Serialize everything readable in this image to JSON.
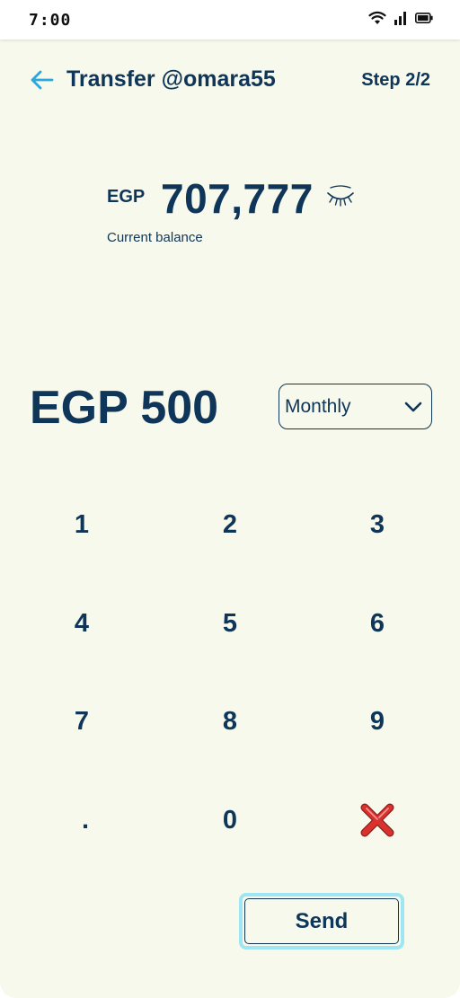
{
  "status_bar": {
    "time": "7:00",
    "icons": [
      "wifi-icon",
      "cell-signal-icon",
      "battery-icon"
    ]
  },
  "header": {
    "back_icon": "arrow-left-icon",
    "title": "Transfer @omara55",
    "step": "Step 2/2"
  },
  "balance": {
    "currency": "EGP",
    "amount": "707,777",
    "visibility_icon": "eye-closed-icon",
    "label": "Current balance"
  },
  "transfer": {
    "amount": "EGP 500",
    "frequency": {
      "selected": "Monthly",
      "icon": "chevron-down-icon"
    }
  },
  "keypad": {
    "keys": [
      "1",
      "2",
      "3",
      "4",
      "5",
      "6",
      "7",
      "8",
      "9",
      ".",
      "0"
    ],
    "delete_icon": "red-x-icon"
  },
  "actions": {
    "send_label": "Send"
  },
  "colors": {
    "primary_text": "#0f3558",
    "background": "#f6f9ec",
    "accent_back_arrow": "#2aa7dc",
    "send_border": "#9ee6f1",
    "delete_red": "#d9322e"
  }
}
